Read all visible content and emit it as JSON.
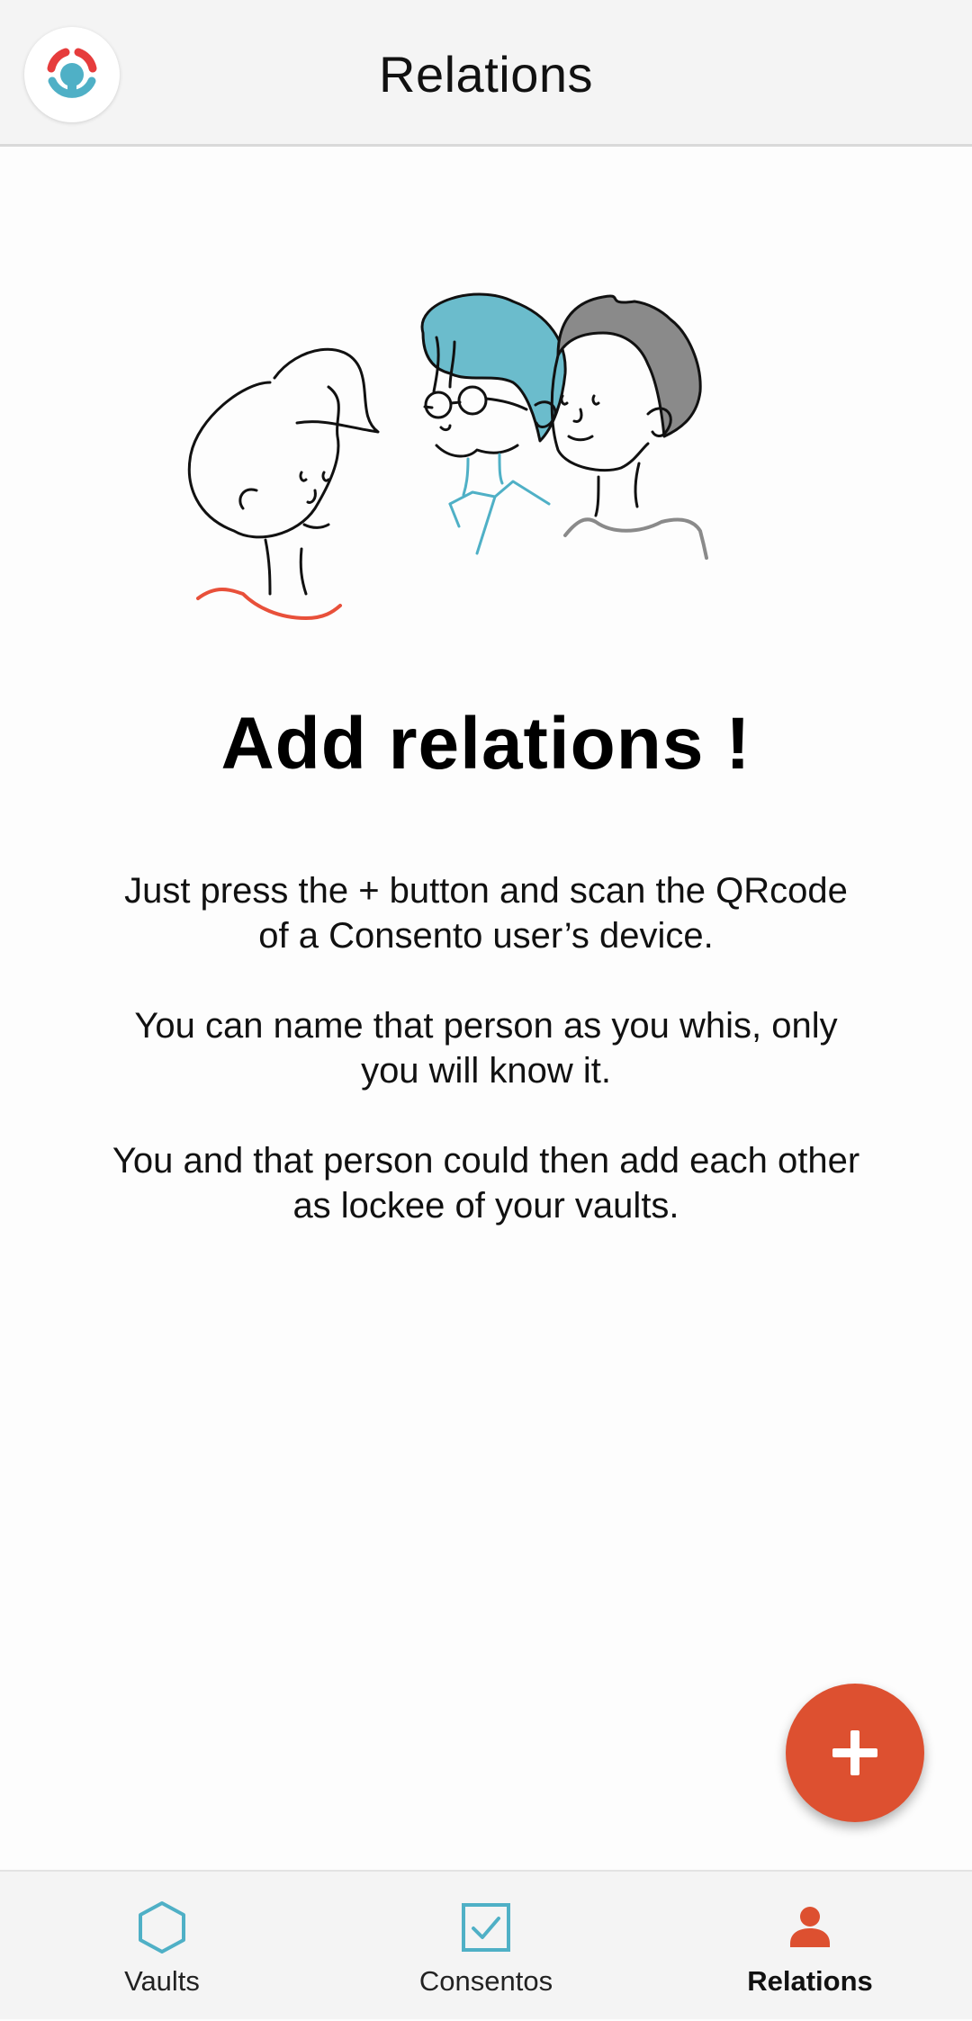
{
  "header": {
    "title": "Relations",
    "logo_icon": "consento-logo-icon"
  },
  "empty_state": {
    "headline": "Add relations !",
    "paragraphs": [
      "Just press the + button and scan the QRcode of a Consento user’s device.",
      "You can name that person as you whis, only you will know it.",
      "You and that person could then add each other as lockee of your vaults."
    ],
    "illustration_icon": "three-people-illustration"
  },
  "fab": {
    "icon": "plus-icon"
  },
  "bottom_nav": {
    "items": [
      {
        "label": "Vaults",
        "icon": "hexagon-icon",
        "active": false
      },
      {
        "label": "Consentos",
        "icon": "checkbox-icon",
        "active": false
      },
      {
        "label": "Relations",
        "icon": "person-icon",
        "active": true
      }
    ]
  },
  "colors": {
    "accent": "#dd5030",
    "teal": "#4fb0c6",
    "logo_red": "#e63c3c",
    "gray_hair": "#8a8a8a"
  }
}
